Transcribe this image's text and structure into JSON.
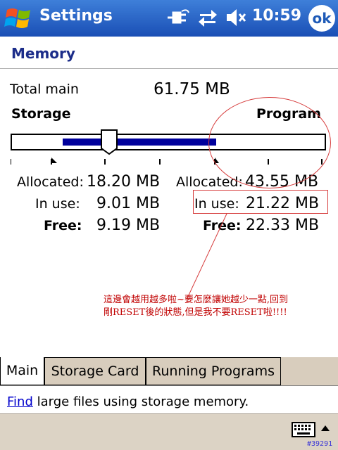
{
  "titlebar": {
    "title": "Settings",
    "clock": "10:59",
    "ok_label": "ok",
    "icons": [
      "windows-start-icon",
      "power-plug-icon",
      "connectivity-arrows-icon",
      "speaker-muted-icon"
    ]
  },
  "page": {
    "heading": "Memory"
  },
  "memory": {
    "total_label": "Total main",
    "total_value": "61.75 MB",
    "storage_label": "Storage",
    "program_label": "Program",
    "slider_position": 0.31,
    "storage": {
      "allocated_label": "Allocated:",
      "allocated_value": "18.20 MB",
      "inuse_label": "In use:",
      "inuse_value": "9.01 MB",
      "free_label": "Free:",
      "free_value": "9.19 MB"
    },
    "program": {
      "allocated_label": "Allocated:",
      "allocated_value": "43.55 MB",
      "inuse_label": "In use:",
      "inuse_value": "21.22 MB",
      "free_label": "Free:",
      "free_value": "22.33 MB"
    }
  },
  "annotation": {
    "line1": "這邊會越用越多啦~要怎麼讓她越少一點,回到",
    "line2": "剛RESET後的狀態,但是我不要RESET啦!!!!",
    "color": "#c00000"
  },
  "tabs": [
    {
      "label": "Main",
      "active": true
    },
    {
      "label": "Storage Card",
      "active": false
    },
    {
      "label": "Running Programs",
      "active": false
    }
  ],
  "find": {
    "link": "Find",
    "text": " large files using storage memory."
  },
  "bottom": {
    "image_id": "#39291"
  },
  "colors": {
    "titlebar": "#1e5ab7",
    "bar_fill": "#00009c",
    "heading": "#1c2d8a",
    "tabbar": "#d8cdbd"
  }
}
